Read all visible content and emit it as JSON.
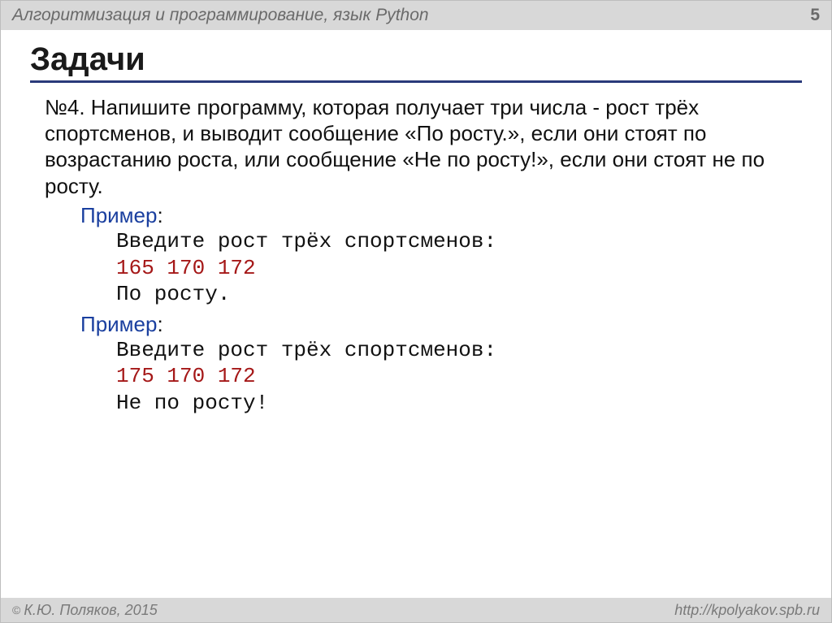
{
  "header": {
    "title": "Алгоритмизация и программирование, язык Python",
    "page": "5"
  },
  "heading": "Задачи",
  "task": {
    "text": "№4. Напишите программу, которая получает три числа  - рост трёх спортсменов, и выводит сообщение «По росту.», если они стоят по возрастанию роста, или сообщение «Не по росту!», если они стоят не по росту."
  },
  "examples": [
    {
      "label": "Пример",
      "prompt": "Введите рост трёх спортсменов:",
      "input": "165 170 172",
      "output": "По росту."
    },
    {
      "label": "Пример",
      "prompt": "Введите рост трёх спортсменов:",
      "input": "175 170 172",
      "output": "Не по росту!"
    }
  ],
  "footer": {
    "copyright_symbol": "©",
    "author": "К.Ю. Поляков, 2015",
    "url": "http://kpolyakov.spb.ru"
  }
}
